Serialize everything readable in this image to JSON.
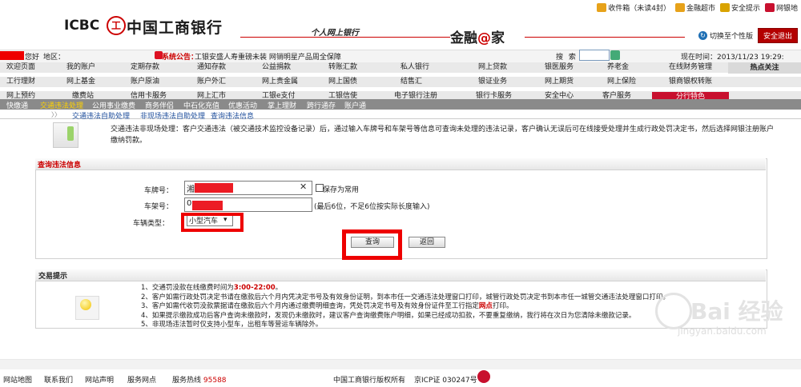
{
  "header": {
    "logo_text": "ICBC",
    "logo_seal": "工",
    "bank_name": "中国工商银行",
    "slogan": "个人网上银行",
    "brand_prefix": "金融",
    "brand_at": "@",
    "brand_suffix": "家",
    "top_links": [
      {
        "label": "收件箱（未读4封）",
        "icon": "mail-icon",
        "color": "#e7a21a"
      },
      {
        "label": "金融超市",
        "icon": "cart-icon",
        "color": "#e7a21a"
      },
      {
        "label": "安全提示",
        "icon": "lock-icon",
        "color": "#d9a300"
      },
      {
        "label": "网银地",
        "icon": "globe-icon",
        "color": "#c8102e"
      }
    ],
    "switch_label": "切换至个性版",
    "safe_exit": "安全退出"
  },
  "status": {
    "greet": "您好",
    "region": "地区：",
    "notice_label": "系统公告：",
    "notice_text": "工银安盛人寿重磅未装 网销明星产品周全保障",
    "search_label": "搜 索",
    "time_label": "现在时间：2013/11/23  19:29:"
  },
  "nav": {
    "rows": [
      [
        "欢迎页面",
        "我的账户",
        "定期存款",
        "通知存款",
        "公益捐款",
        "转账汇款",
        "私人银行",
        "网上贷款",
        "银医服务",
        "养老金",
        "在线财务管理"
      ],
      [
        "工行理财",
        "网上基金",
        "账户原油",
        "账户外汇",
        "网上贵金属",
        "网上国债",
        "结售汇",
        "银证业务",
        "网上期货",
        "网上保险",
        "银商银权转账"
      ],
      [
        "网上预约",
        "缴费站",
        "信用卡服务",
        "网上汇市",
        "工银e支付",
        "工银信使",
        "电子银行注册",
        "银行卡服务",
        "安全中心",
        "客户服务",
        "分行特色"
      ]
    ],
    "hot_focus": "热点关注"
  },
  "subnav": {
    "items": [
      "快缴通",
      "交通违法处理",
      "公用事业缴费",
      "商务伴侣",
      "中石化充值",
      "优惠活动",
      "掌上理财",
      "跨行通存",
      "账户通"
    ],
    "active_index": 1
  },
  "breadcrumb": {
    "arrows": "〉〉",
    "items": [
      "交通违法自助处理",
      "非现场违法自助处理",
      "查询违法信息"
    ]
  },
  "intro": {
    "text": "交通违法非现场处理：客户交通违法（被交通技术监控设备记录）后，通过输入车牌号和车架号等信息可查询未处理的违法记录，客户确认无误后可在线接受处理并生成行政处罚决定书，然后选择网银注册账户缴纳罚款。"
  },
  "query": {
    "title": "查询违法信息",
    "plate_label": "车牌号：",
    "plate_prefix": "湘",
    "clear_symbol": "✕",
    "save_label": "保存为常用",
    "frame_label": "车架号：",
    "frame_prefix": "0",
    "frame_hint": "(最后6位，不足6位按实际长度输入)",
    "type_label": "车辆类型：",
    "type_value": "小型汽车",
    "type_arrow": "▾",
    "query_button": "查询",
    "back_button": "返回"
  },
  "tips": {
    "title": "交易提示",
    "items": [
      {
        "pre": "1、交通罚没款在线缴费时间为",
        "hl": "3:00-22:00",
        "post": "。"
      },
      {
        "pre": "2、客户如需行政处罚决定书请在缴款后六个月内凭决定书号及有效身份证明，到本市任一交通违法处理窗口打印，城管行政处罚决定书到本市任一城管交通违法处理窗口打印。",
        "hl": "",
        "post": ""
      },
      {
        "pre": "3、客户如需代收罚没款票据请在缴款后六个月内通过缴费明细查询，凭处罚决定书号及有效身份证件至工行指定",
        "hl": "网点",
        "post": "打印。"
      },
      {
        "pre": "4、如果提示缴款成功后客户查询未缴款时，发现仍未缴款时，建议客户查询缴费账户明细，如果已经成功扣款，不要重复缴纳，我行将在次日为您清除未缴款记录。",
        "hl": "",
        "post": ""
      },
      {
        "pre": "5、非现场违法暂时仅支持小型车，出租车等营运车辆除外。",
        "hl": "",
        "post": ""
      }
    ]
  },
  "footer": {
    "items": [
      "网站地图",
      "联系我们",
      "网站声明",
      "服务网点"
    ],
    "hotline_label": "服务热线",
    "hotline_num": "95588",
    "copyright": "中国工商银行版权所有",
    "icp": "京ICP证 030247号"
  },
  "watermark": {
    "brand": "Bai 经验",
    "url": "jingyan.baidu.com"
  }
}
